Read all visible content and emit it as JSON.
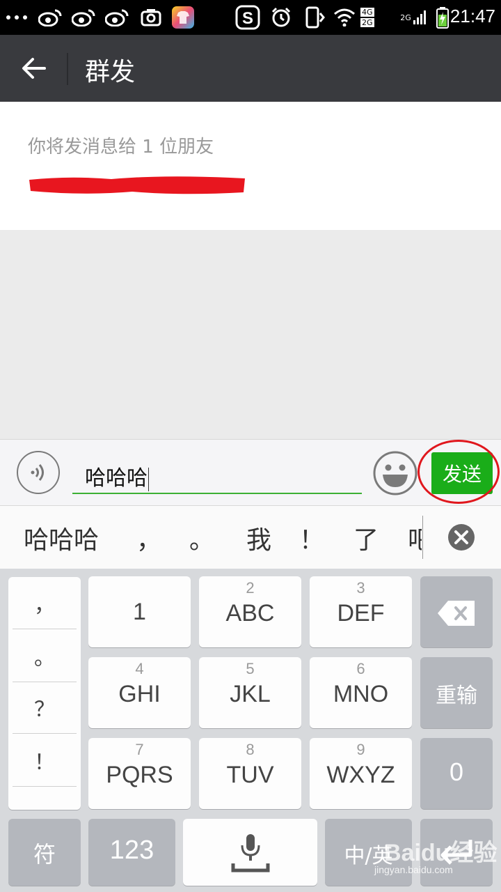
{
  "status_bar": {
    "time": "21:47",
    "network_4g": "4G",
    "network_2g": "2G",
    "network_2g_b": "2G",
    "icons": [
      "more-dots-icon",
      "weibo-icon",
      "weibo-icon",
      "weibo-icon",
      "screenshot-icon",
      "theme-app-icon",
      "sogou-icon",
      "alarm-icon",
      "vibrate-icon",
      "wifi-icon",
      "signal-4g-icon",
      "signal-2g-icon",
      "battery-charging-icon"
    ]
  },
  "app_bar": {
    "title": "群发",
    "back_icon": "arrow-left-icon"
  },
  "recipients": {
    "label": "你将发消息给 1 位朋友",
    "redaction_color": "#e8161f"
  },
  "input_bar": {
    "message_text": "哈哈哈",
    "send_label": "发送",
    "voice_icon": "voice-icon",
    "emoji_icon": "emoji-icon",
    "accent_color": "#1aad19",
    "highlight_color": "#e0171d"
  },
  "candidates": {
    "items": [
      "哈哈哈",
      "，",
      "。",
      "我",
      "！",
      "了",
      "吧"
    ],
    "close_icon": "close-circle-icon"
  },
  "keyboard": {
    "punctuation": [
      "，",
      "。",
      "？",
      "！"
    ],
    "keys_row1": [
      {
        "num": "",
        "label": "1"
      },
      {
        "num": "2",
        "label": "ABC"
      },
      {
        "num": "3",
        "label": "DEF"
      }
    ],
    "keys_row2": [
      {
        "num": "4",
        "label": "GHI"
      },
      {
        "num": "5",
        "label": "JKL"
      },
      {
        "num": "6",
        "label": "MNO"
      }
    ],
    "keys_row3": [
      {
        "num": "7",
        "label": "PQRS"
      },
      {
        "num": "8",
        "label": "TUV"
      },
      {
        "num": "9",
        "label": "WXYZ"
      }
    ],
    "backspace_icon": "backspace-icon",
    "reset_label": "重输",
    "zero_label": "0",
    "symbol_label": "符",
    "numbers_label": "123",
    "mic_icon": "microphone-icon",
    "lang_label": "中/英",
    "enter_icon": "enter-icon"
  },
  "watermark": {
    "logo": "Baidu经验",
    "url": "jingyan.baidu.com"
  }
}
